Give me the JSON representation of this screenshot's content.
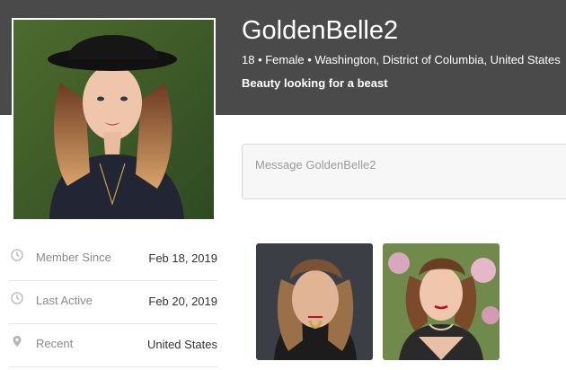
{
  "profile": {
    "username": "GoldenBelle2",
    "meta": "18 • Female • Washington, District of Columbia, United States",
    "tagline": "Beauty looking for a beast",
    "photo_label": "profile photo"
  },
  "message": {
    "placeholder": "Message GoldenBelle2"
  },
  "info": [
    {
      "icon": "clock-icon",
      "label": "Member Since",
      "value": "Feb 18, 2019"
    },
    {
      "icon": "clock-icon",
      "label": "Last Active",
      "value": "Feb 20, 2019"
    },
    {
      "icon": "location-pin-icon",
      "label": "Recent",
      "value": "United States"
    }
  ],
  "gallery": [
    {
      "alt": "photo 1"
    },
    {
      "alt": "photo 2"
    }
  ],
  "colors": {
    "header_bg": "#4a4a4a",
    "header_text": "#ffffff",
    "label_gray": "#8a8a8a"
  }
}
